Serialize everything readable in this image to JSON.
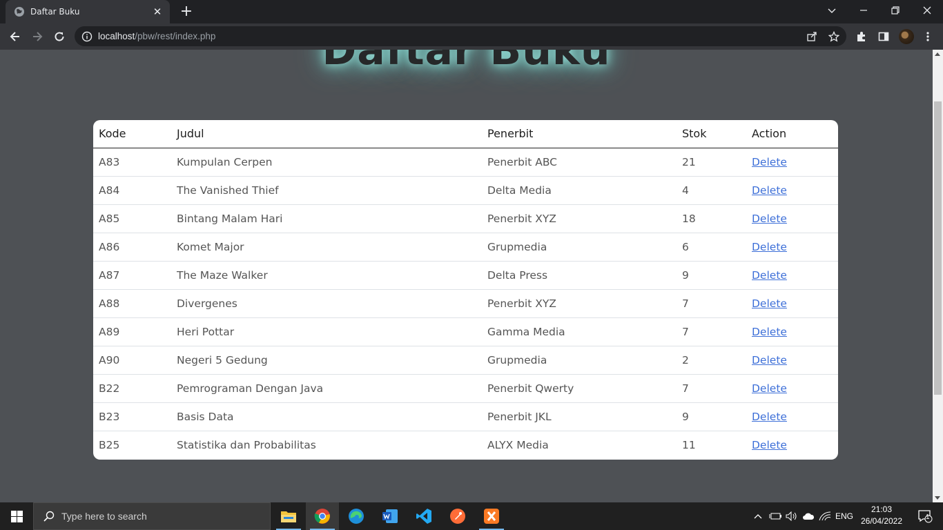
{
  "browser": {
    "tab_title": "Daftar Buku",
    "url_host": "localhost",
    "url_path": "/pbw/rest/index.php"
  },
  "page": {
    "heading": "Daftar Buku",
    "accent_glow": "#9ae2da",
    "link_color": "#3d6fd8",
    "table": {
      "headers": [
        "Kode",
        "Judul",
        "Penerbit",
        "Stok",
        "Action"
      ],
      "rows": [
        {
          "kode": "A83",
          "judul": "Kumpulan Cerpen",
          "penerbit": "Penerbit ABC",
          "stok": "21",
          "action": "Delete"
        },
        {
          "kode": "A84",
          "judul": "The Vanished Thief",
          "penerbit": "Delta Media",
          "stok": "4",
          "action": "Delete"
        },
        {
          "kode": "A85",
          "judul": "Bintang Malam Hari",
          "penerbit": "Penerbit XYZ",
          "stok": "18",
          "action": "Delete"
        },
        {
          "kode": "A86",
          "judul": "Komet Major",
          "penerbit": "Grupmedia",
          "stok": "6",
          "action": "Delete"
        },
        {
          "kode": "A87",
          "judul": "The Maze Walker",
          "penerbit": "Delta Press",
          "stok": "9",
          "action": "Delete"
        },
        {
          "kode": "A88",
          "judul": "Divergenes",
          "penerbit": "Penerbit XYZ",
          "stok": "7",
          "action": "Delete"
        },
        {
          "kode": "A89",
          "judul": "Heri Pottar",
          "penerbit": "Gamma Media",
          "stok": "7",
          "action": "Delete"
        },
        {
          "kode": "A90",
          "judul": "Negeri 5 Gedung",
          "penerbit": "Grupmedia",
          "stok": "2",
          "action": "Delete"
        },
        {
          "kode": "B22",
          "judul": "Pemrograman Dengan Java",
          "penerbit": "Penerbit Qwerty",
          "stok": "7",
          "action": "Delete"
        },
        {
          "kode": "B23",
          "judul": "Basis Data",
          "penerbit": "Penerbit JKL",
          "stok": "9",
          "action": "Delete"
        },
        {
          "kode": "B25",
          "judul": "Statistika dan Probabilitas",
          "penerbit": "ALYX Media",
          "stok": "11",
          "action": "Delete"
        }
      ]
    }
  },
  "taskbar": {
    "search_placeholder": "Type here to search",
    "language": "ENG",
    "time": "21:03",
    "date": "26/04/2022",
    "notification_count": "1",
    "apps": [
      "file-explorer-icon",
      "chrome-icon",
      "edge-icon",
      "word-icon",
      "vscode-icon",
      "postman-icon",
      "xampp-icon"
    ]
  }
}
